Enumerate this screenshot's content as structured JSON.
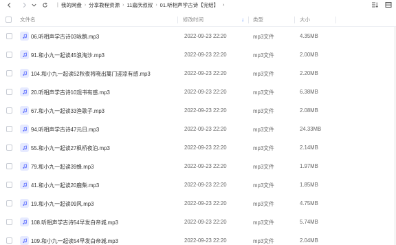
{
  "breadcrumb": {
    "items": [
      "我的网盘",
      "分享教程资源",
      "11嘉庆叔叔",
      "01.听相声学古诗【完结】"
    ],
    "more": "›"
  },
  "columns": {
    "name": "文件名",
    "date": "修改时间",
    "type": "类型",
    "size": "大小"
  },
  "files": [
    {
      "name": "06.听相声学古诗03咏鹅.mp3",
      "date": "2022-09-23 22:20",
      "type": "mp3文件",
      "size": "4.35MB"
    },
    {
      "name": "91.和小九一起读45浪淘沙.mp3",
      "date": "2022-09-23 22:20",
      "type": "mp3文件",
      "size": "2.00MB"
    },
    {
      "name": "104.和小九一起读52秋夜将晓出篱门迎凉有感.mp3",
      "date": "2022-09-23 22:20",
      "type": "mp3文件",
      "size": "2.20MB"
    },
    {
      "name": "20.听相声学古诗10观书有感.mp3",
      "date": "2022-09-23 22:20",
      "type": "mp3文件",
      "size": "6.38MB"
    },
    {
      "name": "67.和小九一起读33渔歌子.mp3",
      "date": "2022-09-23 22:20",
      "type": "mp3文件",
      "size": "2.08MB"
    },
    {
      "name": "94.听相声学古诗47元日.mp3",
      "date": "2022-09-23 22:20",
      "type": "mp3文件",
      "size": "24.33MB"
    },
    {
      "name": "55.和小九一起读27枫桥夜泊.mp3",
      "date": "2022-09-23 22:20",
      "type": "mp3文件",
      "size": "2.14MB"
    },
    {
      "name": "79.和小九一起读39蜂.mp3",
      "date": "2022-09-23 22:20",
      "type": "mp3文件",
      "size": "1.97MB"
    },
    {
      "name": "41.和小九一起读20鹿柴.mp3",
      "date": "2022-09-23 22:20",
      "type": "mp3文件",
      "size": "1.85MB"
    },
    {
      "name": "19.和小九一起读09风.mp3",
      "date": "2022-09-23 22:20",
      "type": "mp3文件",
      "size": "4.75MB"
    },
    {
      "name": "108.听相声学古诗54早发白帝城.mp3",
      "date": "2022-09-23 22:20",
      "type": "mp3文件",
      "size": "5.74MB"
    },
    {
      "name": "109.和小九一起读54早发白帝城.mp3",
      "date": "2022-09-23 22:20",
      "type": "mp3文件",
      "size": "2.04MB"
    }
  ],
  "colors": {
    "accent": "#3a7bff",
    "icon_bg": "#e6eaff",
    "icon_fg": "#5b6cff"
  }
}
